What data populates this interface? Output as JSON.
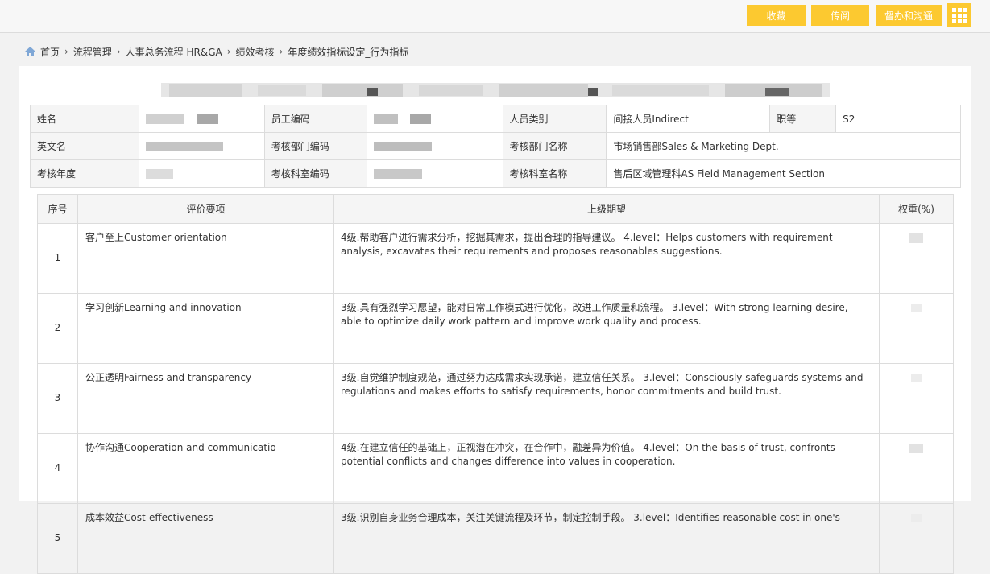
{
  "toolbar": {
    "favorite_label": "收藏",
    "circulate_label": "传阅",
    "supervise_label": "督办和沟通"
  },
  "breadcrumb": {
    "home": "首页",
    "items": [
      "流程管理",
      "人事总务流程 HR&GA",
      "绩效考核",
      "年度绩效指标设定_行为指标"
    ]
  },
  "info": {
    "name_label": "姓名",
    "employee_id_label": "员工编码",
    "category_label": "人员类别",
    "category_value": "间接人员Indirect",
    "grade_label": "职等",
    "grade_value": "S2",
    "english_name_label": "英文名",
    "dept_code_label": "考核部门编码",
    "dept_name_label": "考核部门名称",
    "dept_name_value": "市场销售部Sales & Marketing Dept.",
    "year_label": "考核年度",
    "section_code_label": "考核科室编码",
    "section_name_label": "考核科室名称",
    "section_name_value": "售后区域管理科AS Field Management Section"
  },
  "table": {
    "headers": [
      "序号",
      "评价要项",
      "上级期望",
      "权重(%)"
    ],
    "rows": [
      {
        "no": "1",
        "item": "客户至上Customer orientation",
        "expectation": "4级.帮助客户进行需求分析，挖掘其需求，提出合理的指导建议。 4.level：Helps customers with requirement analysis, excavates their requirements and proposes reasonables suggestions."
      },
      {
        "no": "2",
        "item": "学习创新Learning and innovation",
        "expectation": "3级.具有强烈学习愿望，能对日常工作模式进行优化，改进工作质量和流程。 3.level：With strong learning desire, able to optimize daily work pattern and improve work quality and process."
      },
      {
        "no": "3",
        "item": "公正透明Fairness and transparency",
        "expectation": "3级.自觉维护制度规范，通过努力达成需求实现承诺，建立信任关系。 3.level：Consciously safeguards systems and regulations and makes efforts to satisfy requirements, honor commitments and build trust."
      },
      {
        "no": "4",
        "item": "协作沟通Cooperation and communicatio",
        "expectation": "4级.在建立信任的基础上，正视潜在冲突，在合作中，融差异为价值。  4.level：On the basis of trust, confronts potential conflicts and changes difference into values in cooperation."
      },
      {
        "no": "5",
        "item": "成本效益Cost-effectiveness",
        "expectation": "3级.识别自身业务合理成本，关注关键流程及环节，制定控制手段。 3.level：Identifies reasonable cost in one's"
      }
    ]
  }
}
